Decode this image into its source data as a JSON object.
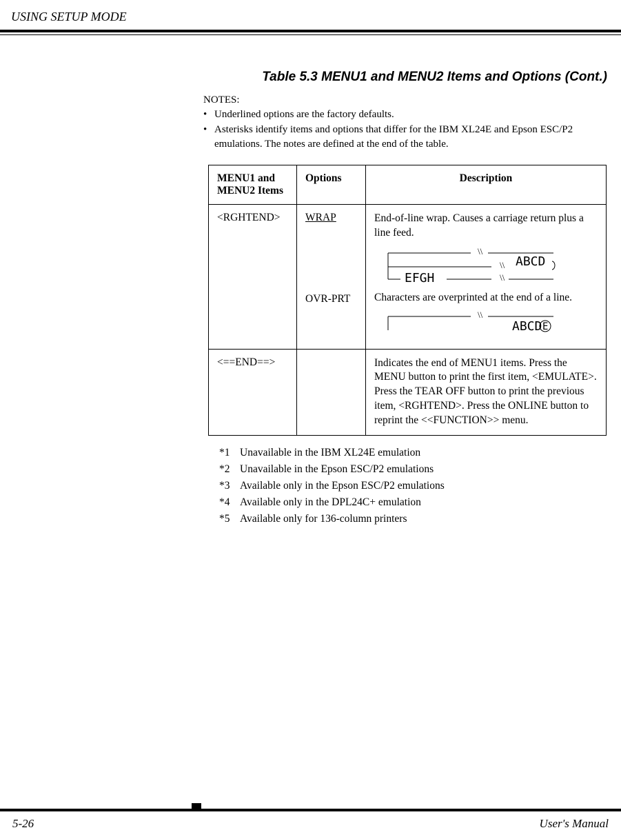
{
  "header": "USING SETUP MODE",
  "table_title": "Table 5.3  MENU1 and MENU2 Items and Options (Cont.)",
  "notes": {
    "label": "NOTES:",
    "items": [
      "Underlined options are the factory defaults.",
      "Asterisks identify items and options that differ for the IBM XL24E and Epson ESC/P2 emulations.  The notes are defined at the end of the table."
    ]
  },
  "columns": {
    "col1": "MENU1 and MENU2 Items",
    "col2": "Options",
    "col3": "Description"
  },
  "rows": [
    {
      "item": "<RGHTEND>",
      "options": [
        {
          "label": "WRAP",
          "underlined": true,
          "desc": "End-of-line wrap.  Causes a carriage return plus a line feed."
        },
        {
          "label": "OVR-PRT",
          "underlined": false,
          "desc": "Characters are overprinted at the end of a line."
        }
      ],
      "diagram1": {
        "line1": "ABCD",
        "line2": "EFGH"
      },
      "diagram2": {
        "line1": "ABCD",
        "overchar": "E"
      }
    },
    {
      "item": "<==END==>",
      "options": [],
      "desc": "Indicates the end of MENU1 items.  Press the MENU button to print the first item, <EMULATE>.  Press the TEAR OFF button to print the previous item, <RGHTEND>.  Press the ONLINE button to reprint the <<FUNCTION>> menu."
    }
  ],
  "footnotes": [
    {
      "key": "*1",
      "text": "Unavailable in the IBM XL24E emulation"
    },
    {
      "key": "*2",
      "text": "Unavailable in the Epson ESC/P2 emulations"
    },
    {
      "key": "*3",
      "text": "Available only in the Epson ESC/P2 emulations"
    },
    {
      "key": "*4",
      "text": "Available only in the DPL24C+ emulation"
    },
    {
      "key": "*5",
      "text": "Available only for 136-column printers"
    }
  ],
  "footer": {
    "page": "5-26",
    "manual": "User's Manual"
  }
}
